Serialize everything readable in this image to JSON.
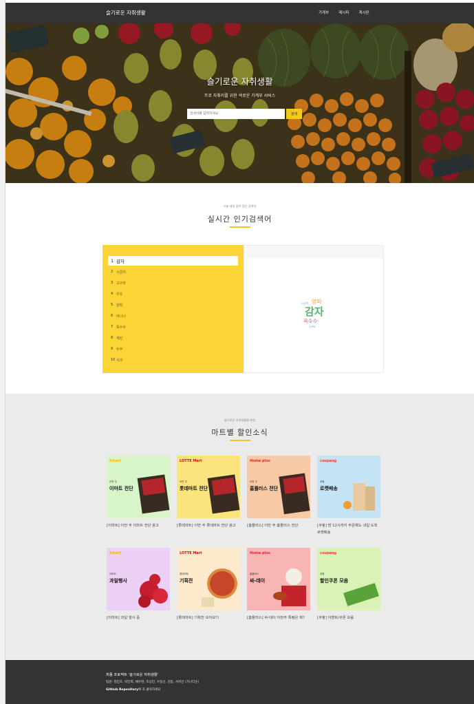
{
  "navbar": {
    "brand": "슬기로운 자취생활",
    "links": [
      "가계부",
      "레시피",
      "게시판"
    ]
  },
  "hero": {
    "title": "슬기로운 자취생활",
    "subtitle": "프로 자취러를 위한 색로운 가계부 서비스",
    "search_placeholder": "검색어를 입력하세요",
    "search_button": "검색"
  },
  "trending": {
    "small": "오늘 제일 많이 찾은 검색어",
    "title": "실시간 인기검색어",
    "items": [
      {
        "rank": "1",
        "label": "감자"
      },
      {
        "rank": "2",
        "label": "시금치"
      },
      {
        "rank": "3",
        "label": "고구마"
      },
      {
        "rank": "4",
        "label": "우유"
      },
      {
        "rank": "5",
        "label": "양파"
      },
      {
        "rank": "6",
        "label": "바나나"
      },
      {
        "rank": "7",
        "label": "옥수수"
      },
      {
        "rank": "8",
        "label": "계란"
      },
      {
        "rank": "9",
        "label": "두부"
      },
      {
        "rank": "10",
        "label": "사과"
      }
    ],
    "cloud": {
      "big": "감자",
      "mid": "양파",
      "mid2": "옥수수",
      "small1": "시금치",
      "small2": "고구마",
      "color_big": "#55b46a",
      "color_mid": "#e9a23b",
      "color_mid2": "#d95ea9"
    }
  },
  "deals": {
    "small": "슬기로운 자취생활을 위한",
    "title": "마트별 할인소식",
    "cards": [
      {
        "brand": "Emart",
        "brand_color": "#f5b800",
        "bg": "#d8f5c9",
        "tag": "이번 주",
        "head": "이마트 전단",
        "caption": "[이마트] 이번 주 이마트 전단 광고"
      },
      {
        "brand": "LOTTE Mart",
        "brand_color": "#e60012",
        "bg": "#fbe37d",
        "tag": "이번 주",
        "head": "롯데마트 전단",
        "caption": "[롯데마트] 이번 주 롯데마트 전단 광고"
      },
      {
        "brand": "Home plus",
        "brand_color": "#e2222a",
        "bg": "#f7c9a4",
        "tag": "이번 주",
        "head": "홈플러스 전단",
        "caption": "[홈플러스] 이번 주 홈플러스 전단"
      },
      {
        "brand": "coupang",
        "brand_color": "#e8423b",
        "bg": "#c4e4f5",
        "tag": "쿠팡",
        "head": "로켓배송",
        "caption": "[쿠팡] 밤 12시까지 주문해도 내일 도착 로켓배송"
      },
      {
        "brand": "Emart",
        "brand_color": "#f5b800",
        "bg": "#ecd0f5",
        "tag": "이마트",
        "head": "과일행사",
        "caption": "[이마트] 과일 행사 중"
      },
      {
        "brand": "LOTTE Mart",
        "brand_color": "#e60012",
        "bg": "#fde9cc",
        "tag": "롯데마트",
        "head": "기획전",
        "caption": "[롯데마트] 기획전 모아보기"
      },
      {
        "brand": "Home plus",
        "brand_color": "#e2222a",
        "bg": "#f9b4b4",
        "tag": "홈플러스",
        "head": "싸-데이",
        "caption": "[홈플러스] 싸-데이 이번주 특템은 뭐?"
      },
      {
        "brand": "coupang",
        "brand_color": "#e8423b",
        "bg": "#d9f2b5",
        "tag": "쿠팡",
        "head": "할인쿠폰 모음",
        "caption": "[쿠팡] 이벤트/쿠폰 모음"
      }
    ]
  },
  "footer": {
    "line1": "최종 프로젝트 '슬기로운 자취생활'",
    "line2": "팀원: 정민호, 박진희, 채수현, 조상민, 우동선, 김동, 서지선 (가나다순)",
    "line3_bold": "Github Repository",
    "line3_rest": "에 꼭 클릭하세요"
  },
  "colors": {
    "accent": "#fdd435",
    "nav": "#333333"
  }
}
